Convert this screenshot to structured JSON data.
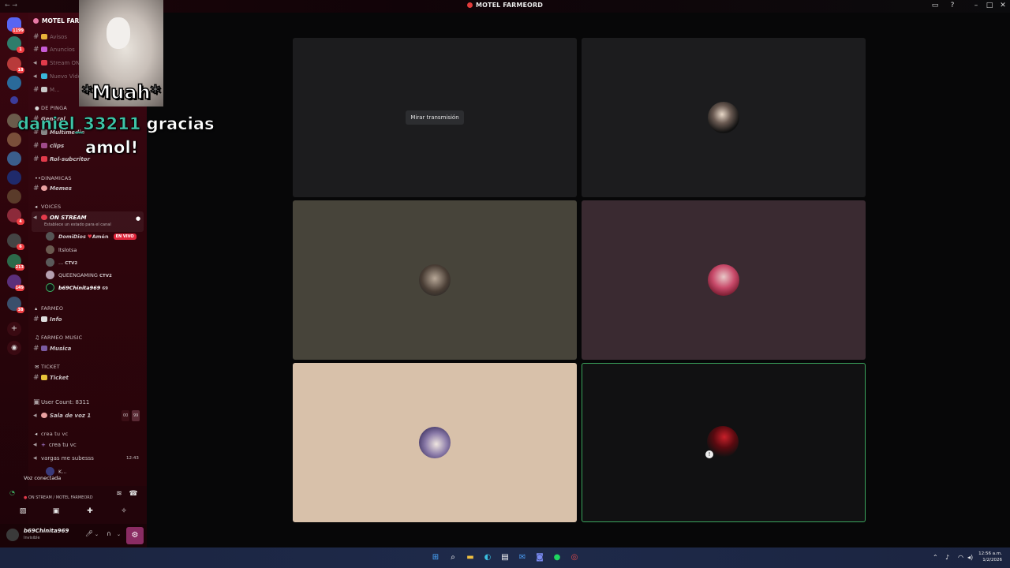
{
  "window": {
    "title": "MOTEL FARMEORD"
  },
  "server": {
    "name": "MOTEL FARMEORD"
  },
  "rail_badges": [
    "1199",
    "1",
    "18",
    "4",
    "6",
    "213",
    "149",
    "38"
  ],
  "top_channels": [
    {
      "label": "Avisos"
    },
    {
      "label": "Anuncios"
    },
    {
      "label": "Stream ON"
    },
    {
      "label": "Nuevo Video"
    },
    {
      "label": "M..."
    }
  ],
  "categories": {
    "de_pinga": "DE PINGA",
    "dinamicas": "DINAMICAS",
    "voices": "VOICES",
    "farmeo": "FARMEO",
    "farmeo_music": "FARMEO MUSIC",
    "ticket": "TICKET"
  },
  "channels": {
    "general": "General",
    "multimedia": "Multimedia",
    "clips": "clips",
    "rol": "Rol-subcritor",
    "memes": "Memes",
    "on_stream": "ON STREAM",
    "info": "Info",
    "musica": "Musica",
    "ticket": "Ticket",
    "user_count": "User Count: 8311",
    "sala": "Sala de voz 1",
    "crea_cat": "crea tu vc",
    "crea": "crea tu vc",
    "vargas": "vargas me subesss"
  },
  "status_hint": "Establece un estado para el canal",
  "voice_members": [
    {
      "name": "DomiDios",
      "tag": "Amén",
      "live": "EN VIVO"
    },
    {
      "name": "ltslotsa",
      "tag": ""
    },
    {
      "name": "...",
      "tag": "CTV2"
    },
    {
      "name": "QUEENGAMING",
      "tag": "CTV2"
    },
    {
      "name": "b69Chinita969",
      "tag": "69"
    }
  ],
  "sala_counts": {
    "a": "00",
    "b": "99"
  },
  "vargas_time": "12:43",
  "vargas_member": "K...",
  "voice_panel": {
    "status": "Voz conectada",
    "channel": "ON STREAM / MOTEL FARMEORD"
  },
  "user": {
    "name": "b69Chinita969",
    "status": "Invisible"
  },
  "overlay": {
    "caption": "*Muah*",
    "alert_user": "daniel_33211",
    "alert_text1": "gracias",
    "alert_text2": "amol!"
  },
  "stage": {
    "watch_label": "Mirar transmisión"
  },
  "tiles": [
    {
      "bg": "#1c1c1e"
    },
    {
      "bg": "#1c1c1e"
    },
    {
      "bg": "#47443a"
    },
    {
      "bg": "#3a2a31"
    },
    {
      "bg": "#d8c1aa"
    },
    {
      "bg": "#111112",
      "speaking": true
    }
  ],
  "clock": {
    "time": "12:56 a.m.",
    "date": "1/2/2026"
  }
}
